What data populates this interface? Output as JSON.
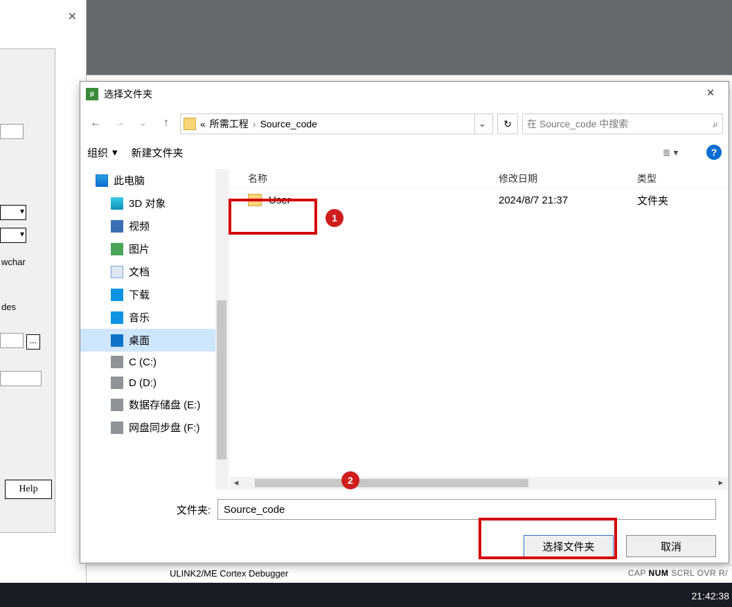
{
  "back_dialog": {
    "close_glyph": "✕",
    "labels": {
      "wchar": "wchar",
      "des": "des"
    },
    "help_label": "Help",
    "ellipsis_label": "..."
  },
  "status_bar": {
    "debugger": "ULINK2/ME Cortex Debugger",
    "indicators": [
      "CAP",
      "NUM",
      "SCRL",
      "OVR",
      "R/"
    ],
    "active_indicator": "NUM"
  },
  "taskbar": {
    "clock": "21:42:38"
  },
  "dialog": {
    "title": "选择文件夹",
    "close_glyph": "✕",
    "nav": {
      "back": "←",
      "forward": "→",
      "recent": "⌄",
      "up": "↑",
      "refresh": "↻"
    },
    "breadcrumb": {
      "prefix": "«",
      "parts": [
        "所需工程",
        "Source_code"
      ],
      "sep": "›"
    },
    "search": {
      "placeholder": "在 Source_code 中搜索",
      "icon": "⌕"
    },
    "toolbar": {
      "organize": "组织",
      "new_folder": "新建文件夹",
      "view_glyph": "≣",
      "help_glyph": "?"
    },
    "tree": {
      "root": "此电脑",
      "items": [
        {
          "label": "3D 对象",
          "icon": "ic-cube"
        },
        {
          "label": "视频",
          "icon": "ic-video"
        },
        {
          "label": "图片",
          "icon": "ic-pic"
        },
        {
          "label": "文档",
          "icon": "ic-doc"
        },
        {
          "label": "下载",
          "icon": "ic-dl"
        },
        {
          "label": "音乐",
          "icon": "ic-music"
        },
        {
          "label": "桌面",
          "icon": "ic-desk",
          "selected": true
        },
        {
          "label": "C (C:)",
          "icon": "ic-drive"
        },
        {
          "label": "D (D:)",
          "icon": "ic-drive"
        },
        {
          "label": "数据存储盘 (E:)",
          "icon": "ic-drive"
        },
        {
          "label": "网盘同步盘 (F:)",
          "icon": "ic-drive"
        }
      ]
    },
    "filelist": {
      "columns": {
        "name": "名称",
        "date": "修改日期",
        "type": "类型"
      },
      "rows": [
        {
          "name": "User",
          "date": "2024/8/7 21:37",
          "type": "文件夹"
        }
      ]
    },
    "folder_field": {
      "label": "文件夹:",
      "value": "Source_code"
    },
    "buttons": {
      "select": "选择文件夹",
      "cancel": "取消"
    },
    "annotations": {
      "badge1": "1",
      "badge2": "2"
    }
  }
}
